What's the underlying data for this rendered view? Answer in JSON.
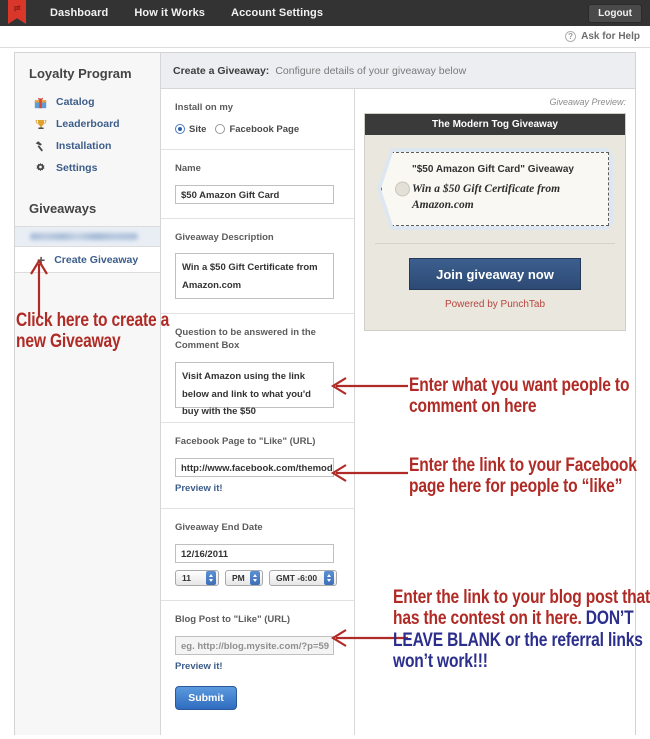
{
  "topnav": {
    "logo_text": "pt",
    "links": [
      "Dashboard",
      "How it Works",
      "Account Settings"
    ],
    "logout_label": "Logout"
  },
  "helpbar": {
    "text": "Ask for Help",
    "icon": "question-circle-icon"
  },
  "sidebar": {
    "section1_title": "Loyalty Program",
    "items": [
      {
        "label": "Catalog",
        "icon": "gift-icon"
      },
      {
        "label": "Leaderboard",
        "icon": "trophy-icon"
      },
      {
        "label": "Installation",
        "icon": "hammer-icon"
      },
      {
        "label": "Settings",
        "icon": "gear-icon"
      }
    ],
    "section2_title": "Giveaways",
    "redacted_item": "",
    "create_label": "Create Giveaway"
  },
  "content_header": {
    "strong": "Create a Giveaway:",
    "sub": "Configure details of your giveaway below"
  },
  "form": {
    "install_label": "Install on my",
    "install_options": [
      "Site",
      "Facebook Page"
    ],
    "install_selected": "Site",
    "name_label": "Name",
    "name_value": "$50 Amazon Gift Card",
    "description_label": "Giveaway Description",
    "description_value": "Win a $50 Gift Certificate from Amazon.com",
    "question_label": "Question to be answered in the Comment Box",
    "question_value": "Visit Amazon using the link below and link to what you'd buy with the $50",
    "fb_label": "Facebook Page to \"Like\" (URL)",
    "fb_value": "http://www.facebook.com/themoderntog",
    "fb_preview": "Preview it!",
    "date_label": "Giveaway End Date",
    "date_value": "12/16/2011",
    "hour_value": "11",
    "ampm_value": "PM",
    "tz_value": "GMT -6:00",
    "blog_label": "Blog Post to \"Like\" (URL)",
    "blog_placeholder": "eg. http://blog.mysite.com/?p=59",
    "blog_preview": "Preview it!",
    "submit_label": "Submit"
  },
  "preview": {
    "caption": "Giveaway Preview:",
    "header": "The Modern Tog Giveaway",
    "tag_title": "\"$50 Amazon Gift Card\" Giveaway",
    "tag_description": "Win a $50 Gift Certificate from Amazon.com",
    "join_label": "Join giveaway now",
    "powered": "Powered by PunchTab"
  },
  "annotations": {
    "create": "Click here to create a new Giveaway",
    "comment": "Enter what you want people to comment on here",
    "facebook": "Enter the link to your Facebook page here for people to “like”",
    "blog_red": "Enter the link to your blog post that has the contest on it here.",
    "blog_blue": "DON’T LEAVE BLANK or the referral links won’t work!!!"
  },
  "colors": {
    "annotation_red": "#b02b26",
    "annotation_blue": "#2b2e8c",
    "nav_bg": "#333333",
    "link_blue": "#3c5d8a",
    "submit_blue": "#2f6cc0"
  }
}
